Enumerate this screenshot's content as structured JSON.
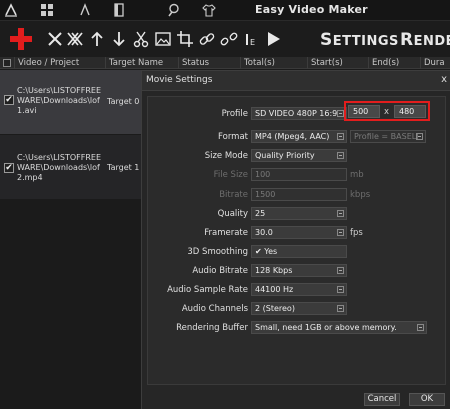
{
  "app": {
    "title": "Easy Video Maker"
  },
  "titlebar_icons": [
    "logo-icon",
    "grid-icon",
    "brush-icon",
    "book-icon",
    "search-icon",
    "shirt-icon"
  ],
  "toolbar": {
    "icons": [
      "add-icon",
      "close-icon",
      "double-close-icon",
      "arrow-up-icon",
      "arrow-down-icon",
      "scissors-icon",
      "image-icon",
      "crop-icon",
      "link-icon",
      "unlink-icon",
      "info-icon",
      "play-icon"
    ],
    "settings_cap": "S",
    "settings_rest": "ETTINGS",
    "render_cap": "R",
    "render_rest": "ENDER"
  },
  "table": {
    "columns": [
      "Video / Project",
      "Target Name",
      "Status",
      "Total(s)",
      "Start(s)",
      "End(s)",
      "Dura"
    ],
    "rows": [
      {
        "path": "C:\\Users\\LISTOFFREEWARE\\Downloads\\lof1.avi",
        "target": "Target 0",
        "checked": true
      },
      {
        "path": "C:\\Users\\LISTOFFREEWARE\\Downloads\\lof2.mp4",
        "target": "Target 1",
        "checked": true
      }
    ]
  },
  "dialog": {
    "title": "Movie Settings",
    "close": "x",
    "profile": {
      "label": "Profile",
      "value": "SD VIDEO 480P 16:9",
      "width": "500",
      "separator": "x",
      "height": "480"
    },
    "format": {
      "label": "Format",
      "value": "MP4 (Mpeg4, AAC)",
      "sub_value": "Profile = BASELI"
    },
    "size_mode": {
      "label": "Size Mode",
      "value": "Quality Priority"
    },
    "file_size": {
      "label": "File Size",
      "value": "100",
      "unit": "mb"
    },
    "bitrate": {
      "label": "Bitrate",
      "value": "1500",
      "unit": "kbps"
    },
    "quality": {
      "label": "Quality",
      "value": "25"
    },
    "framerate": {
      "label": "Framerate",
      "value": "30.0",
      "unit": "fps"
    },
    "smoothing": {
      "label": "3D Smoothing",
      "value": "Yes",
      "checked": "✔"
    },
    "audio_bitrate": {
      "label": "Audio Bitrate",
      "value": "128 Kbps"
    },
    "audio_sample_rate": {
      "label": "Audio Sample Rate",
      "value": "44100 Hz"
    },
    "audio_channels": {
      "label": "Audio Channels",
      "value": "2 (Stereo)"
    },
    "rendering_buffer": {
      "label": "Rendering Buffer",
      "value": "Small, need 1GB or above memory."
    },
    "cancel": "Cancel",
    "ok": "OK"
  },
  "colors": {
    "highlight": "#e21d1d",
    "add": "#e21d1d",
    "row_selected": "#3a3a3e"
  }
}
